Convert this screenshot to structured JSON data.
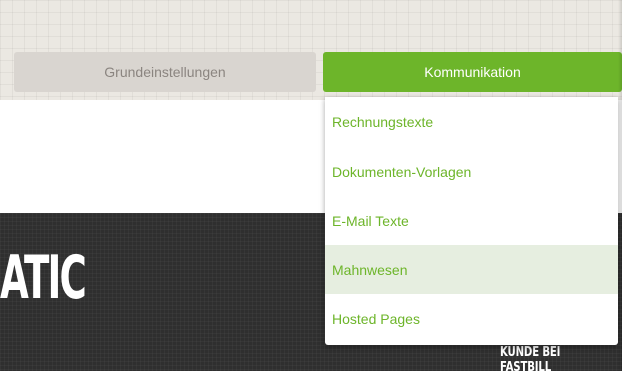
{
  "nav": {
    "tabs": [
      {
        "label": "Grundeinstellungen",
        "active": false
      },
      {
        "label": "Kommunikation",
        "active": true
      }
    ]
  },
  "dropdown": {
    "items": [
      {
        "label": "Rechnungstexte",
        "highlighted": false
      },
      {
        "label": "Dokumenten-Vorlagen",
        "highlighted": false
      },
      {
        "label": "E-Mail Texte",
        "highlighted": false
      },
      {
        "label": "Mahnwesen",
        "highlighted": true
      },
      {
        "label": "Hosted Pages",
        "highlighted": false
      }
    ]
  },
  "banner": {
    "headline_fragment": "ATIC",
    "tagline_fragment": "KUNDE BEI FASTBILL"
  },
  "colors": {
    "accent": "#6db52a",
    "inactive_tab_bg": "#d9d5d0",
    "inactive_tab_text": "#8b8580",
    "banner_bg": "#2f2f2f",
    "hover_bg": "#e6eee0"
  }
}
